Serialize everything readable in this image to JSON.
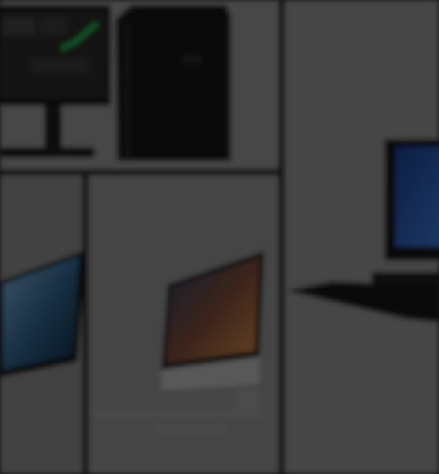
{
  "overlay": {
    "scrim_color": "#000000",
    "scrim_opacity": 0.52
  },
  "gallery": {
    "tiles": [
      {
        "name": "workstation-tile",
        "subject": "tower-workstation-with-monitor",
        "accent": "#1fbf5a"
      },
      {
        "name": "laptop-tile",
        "subject": "laptop",
        "accent": "#3a8ec8"
      },
      {
        "name": "all-in-one-tile",
        "subject": "all-in-one-desktop",
        "accent": "#e08a3a"
      },
      {
        "name": "desktop-keyboard-tile",
        "subject": "all-in-one-with-keyboard",
        "accent": "#2f6fd0"
      }
    ]
  },
  "colors": {
    "tile_bg": "#8d8d8d",
    "divider": "#1e1e1e",
    "device_dark": "#151515"
  }
}
